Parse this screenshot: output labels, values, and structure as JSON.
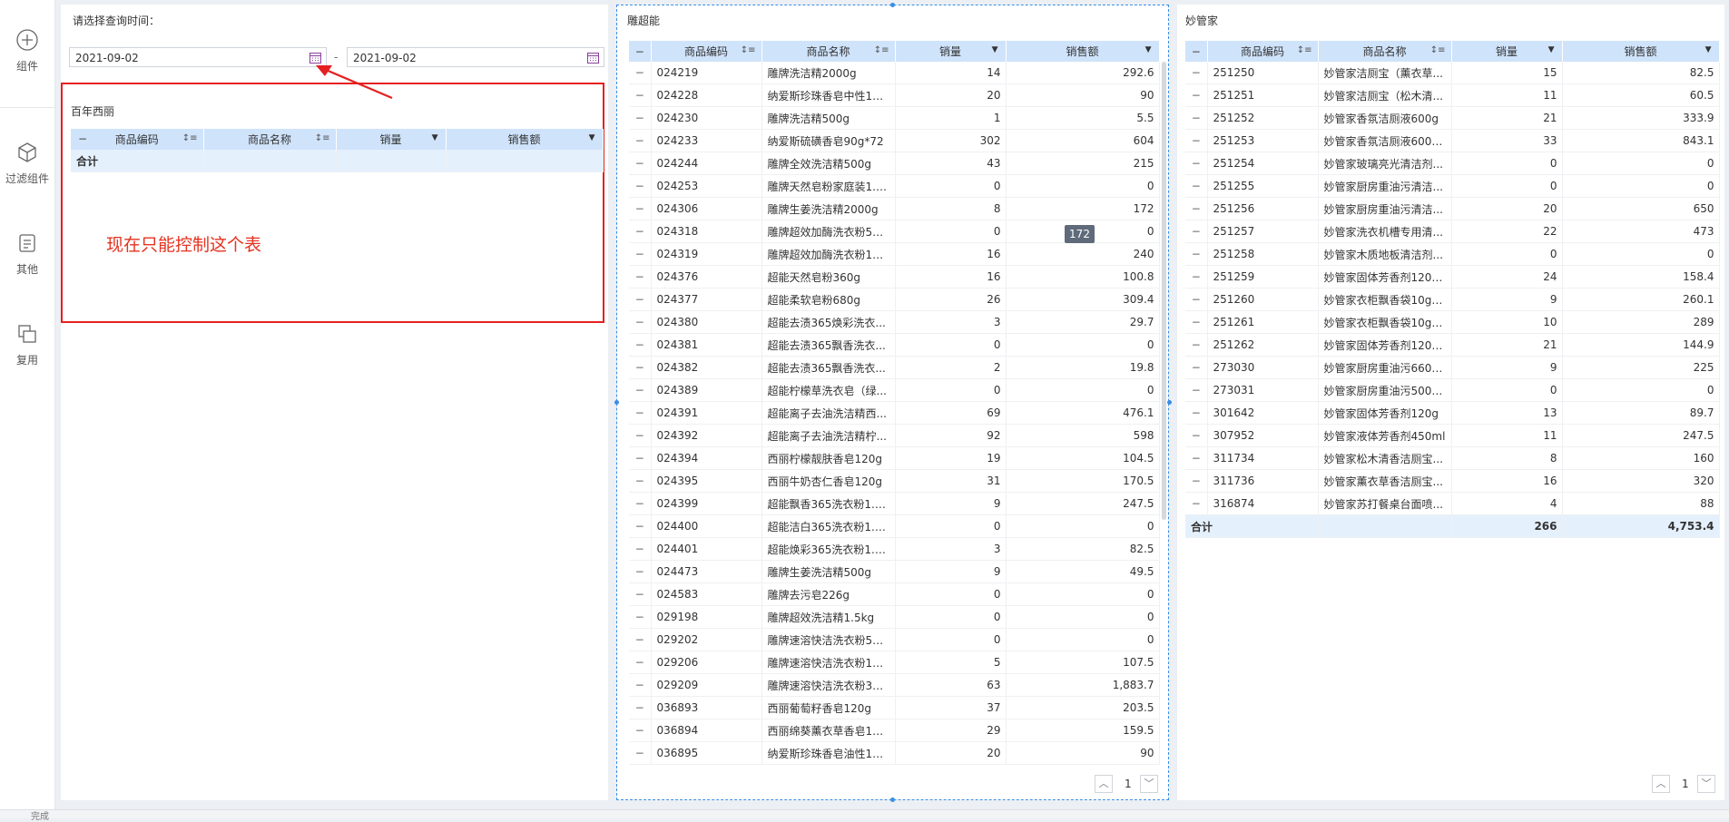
{
  "sidebar": {
    "items": [
      {
        "label": "组件",
        "icon": "plus-circle-icon"
      },
      {
        "label": "过滤组件",
        "icon": "cube-icon"
      },
      {
        "label": "其他",
        "icon": "document-icon"
      },
      {
        "label": "复用",
        "icon": "copy-icon"
      }
    ]
  },
  "filter": {
    "label": "请选择查询时间：",
    "start_date": "2021-09-02",
    "end_date": "2021-09-02",
    "separator": "-"
  },
  "annotation": {
    "text": "现在只能控制这个表",
    "color": "#e53320"
  },
  "table1": {
    "title": "百年西丽",
    "headers": [
      "商品编码",
      "商品名称",
      "销量",
      "销售额"
    ],
    "total_label": "合计"
  },
  "table2": {
    "title": "雕超能",
    "headers": [
      "商品编码",
      "商品名称",
      "销量",
      "销售额"
    ],
    "tooltip": "172",
    "page": "1",
    "rows": [
      [
        "024219",
        "雕牌洗洁精2000g",
        "14",
        "292.6"
      ],
      [
        "024228",
        "纳爱斯珍珠香皂中性12...",
        "20",
        "90"
      ],
      [
        "024230",
        "雕牌洗洁精500g",
        "1",
        "5.5"
      ],
      [
        "024233",
        "纳爱斯硫磺香皂90g*72",
        "302",
        "604"
      ],
      [
        "024244",
        "雕牌全效洗洁精500g",
        "43",
        "215"
      ],
      [
        "024253",
        "雕牌天然皂粉家庭装1.6...",
        "0",
        "0"
      ],
      [
        "024306",
        "雕牌生姜洗洁精2000g",
        "8",
        "172"
      ],
      [
        "024318",
        "雕牌超效加酶洗衣粉56...",
        "0",
        "0"
      ],
      [
        "024319",
        "雕牌超效加酶洗衣粉16...",
        "16",
        "240"
      ],
      [
        "024376",
        "超能天然皂粉360g",
        "16",
        "100.8"
      ],
      [
        "024377",
        "超能柔软皂粉680g",
        "26",
        "309.4"
      ],
      [
        "024380",
        "超能去渍365焕彩洗衣...",
        "3",
        "29.7"
      ],
      [
        "024381",
        "超能去渍365飘香洗衣...",
        "0",
        "0"
      ],
      [
        "024382",
        "超能去渍365飘香洗衣...",
        "2",
        "19.8"
      ],
      [
        "024389",
        "超能柠檬草洗衣皂（绿...",
        "0",
        "0"
      ],
      [
        "024391",
        "超能离子去油洗洁精西...",
        "69",
        "476.1"
      ],
      [
        "024392",
        "超能离子去油洗洁精柠...",
        "92",
        "598"
      ],
      [
        "024394",
        "西丽柠檬靓肤香皂120g",
        "19",
        "104.5"
      ],
      [
        "024395",
        "西丽牛奶杏仁香皂120g",
        "31",
        "170.5"
      ],
      [
        "024399",
        "超能飘香365洗衣粉1.8...",
        "9",
        "247.5"
      ],
      [
        "024400",
        "超能洁白365洗衣粉1.8...",
        "0",
        "0"
      ],
      [
        "024401",
        "超能焕彩365洗衣粉1.8...",
        "3",
        "82.5"
      ],
      [
        "024473",
        "雕牌生姜洗洁精500g",
        "9",
        "49.5"
      ],
      [
        "024583",
        "雕牌去污皂226g",
        "0",
        "0"
      ],
      [
        "029198",
        "雕牌超效洗洁精1.5kg",
        "0",
        "0"
      ],
      [
        "029202",
        "雕牌速溶快洁洗衣粉56...",
        "0",
        "0"
      ],
      [
        "029206",
        "雕牌速溶快洁洗衣粉18...",
        "5",
        "107.5"
      ],
      [
        "029209",
        "雕牌速溶快洁洗衣粉30...",
        "63",
        "1,883.7"
      ],
      [
        "036893",
        "西丽葡萄籽香皂120g",
        "37",
        "203.5"
      ],
      [
        "036894",
        "西丽绵葵薰衣草香皂12...",
        "29",
        "159.5"
      ],
      [
        "036895",
        "纳爱斯珍珠香皂油性12...",
        "20",
        "90"
      ]
    ]
  },
  "table3": {
    "title": "妙管家",
    "headers": [
      "商品编码",
      "商品名称",
      "销量",
      "销售额"
    ],
    "page": "1",
    "rows": [
      [
        "251250",
        "妙管家洁厕宝（薰衣草...",
        "15",
        "82.5"
      ],
      [
        "251251",
        "妙管家洁厕宝（松木清...",
        "11",
        "60.5"
      ],
      [
        "251252",
        "妙管家香氛洁厕液600g",
        "21",
        "333.9"
      ],
      [
        "251253",
        "妙管家香氛洁厕液600g...",
        "33",
        "843.1"
      ],
      [
        "251254",
        "妙管家玻璃亮光清洁剂...",
        "0",
        "0"
      ],
      [
        "251255",
        "妙管家厨房重油污清洁...",
        "0",
        "0"
      ],
      [
        "251256",
        "妙管家厨房重油污清洁...",
        "20",
        "650"
      ],
      [
        "251257",
        "妙管家洗衣机槽专用清...",
        "22",
        "473"
      ],
      [
        "251258",
        "妙管家木质地板清洁剂...",
        "0",
        "0"
      ],
      [
        "251259",
        "妙管家固体芳香剂120g...",
        "24",
        "158.4"
      ],
      [
        "251260",
        "妙管家衣柜飘香袋10g*...",
        "9",
        "260.1"
      ],
      [
        "251261",
        "妙管家衣柜飘香袋10g*...",
        "10",
        "289"
      ],
      [
        "251262",
        "妙管家固体芳香剂120g...",
        "21",
        "144.9"
      ],
      [
        "273030",
        "妙管家厨房重油污660g...",
        "9",
        "225"
      ],
      [
        "273031",
        "妙管家厨房重油污500g...",
        "0",
        "0"
      ],
      [
        "301642",
        "妙管家固体芳香剂120g",
        "13",
        "89.7"
      ],
      [
        "307952",
        "妙管家液体芳香剂450ml",
        "11",
        "247.5"
      ],
      [
        "311734",
        "妙管家松木清香洁厕宝...",
        "8",
        "160"
      ],
      [
        "311736",
        "妙管家薰衣草香洁厕宝...",
        "16",
        "320"
      ],
      [
        "316874",
        "妙管家苏打餐桌台面喷...",
        "4",
        "88"
      ]
    ],
    "total": {
      "label": "合计",
      "qty": "266",
      "amount": "4,753.4"
    }
  },
  "statusbar": {
    "text": "完成"
  }
}
